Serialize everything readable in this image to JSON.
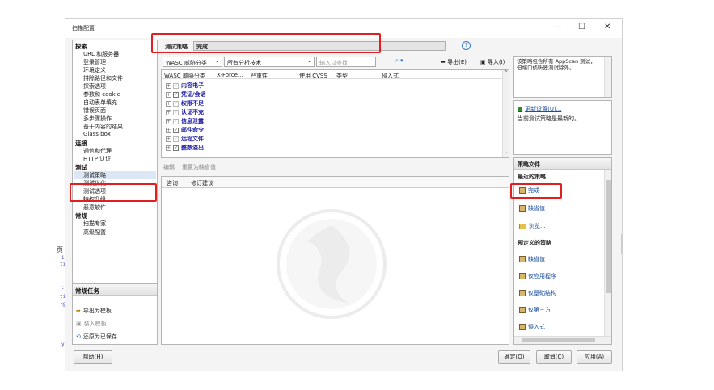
{
  "window": {
    "title": "扫描配置",
    "minimize": "—",
    "maximize": "☐",
    "close": "✕"
  },
  "background_fragments": [
    "页",
    "in",
    "til",
    ":",
    "til",
    "r@",
    "y"
  ],
  "nav": {
    "sections": [
      {
        "header": "探索",
        "items": [
          "URL 和服务器",
          "登录管理",
          "环境定义",
          "排除路径和文件",
          "探索选项",
          "参数和 cookie",
          "自动表单填充",
          "错误页面",
          "多步骤操作",
          "基于内容的结果",
          "Glass box"
        ]
      },
      {
        "header": "连接",
        "items": [
          "通信和代理",
          "HTTP 认证"
        ]
      },
      {
        "header": "测试",
        "items": [
          "测试策略",
          "测试优化",
          "测试选项",
          "特权升级",
          "恶意软件"
        ]
      },
      {
        "header": "常规",
        "items": [
          "扫描专家",
          "高级配置"
        ]
      }
    ],
    "selected": "测试策略"
  },
  "tasks": {
    "header": "常规任务",
    "items": [
      "导出为模板",
      "装入模板",
      "还原为已保存"
    ]
  },
  "policy": {
    "label": "测试策略",
    "value": "完成",
    "help": "?"
  },
  "toolbar": {
    "category_select": "WASC 威胁分类",
    "tech_select": "所有分析技术",
    "search_placeholder": "输入以查找",
    "export": "导出(E)",
    "import": "导入(I)"
  },
  "table": {
    "columns": [
      "WASC 威胁分类",
      "X-Force...",
      "严重性",
      "使用 CVSS",
      "类型",
      "侵入式"
    ],
    "rows": [
      {
        "label": "内容电子",
        "checked": false
      },
      {
        "label": "凭证/会话",
        "checked": true
      },
      {
        "label": "权限不足",
        "checked": false
      },
      {
        "label": "认证不充",
        "checked": false
      },
      {
        "label": "信息泄露",
        "checked": false
      },
      {
        "label": "邮件命令",
        "checked": true
      },
      {
        "label": "远程文件",
        "checked": false
      },
      {
        "label": "整数溢出",
        "checked": true
      }
    ]
  },
  "info_box": {
    "text": "该策略包含所有 AppScan 测试，但端口侦听器测试除外。"
  },
  "update": {
    "link": "更新设置(U)...",
    "status": "当前测试策略是最新的。"
  },
  "edit_bar": {
    "edit": "编辑",
    "reset": "重置为缺省值"
  },
  "detail_tabs": [
    "咨询",
    "修订建议"
  ],
  "policy_files": {
    "header": "策略文件",
    "recent_header": "最近的策略",
    "recent": [
      "完成",
      "缺省值",
      "浏览..."
    ],
    "predefined_header": "预定义的策略",
    "predefined": [
      "缺省值",
      "仅应用程序",
      "仅基础结构",
      "仅第三方",
      "侵入式"
    ]
  },
  "footer": {
    "help": "帮助(H)",
    "ok": "确定(O)",
    "cancel": "取消(C)",
    "apply": "应用(A)"
  }
}
